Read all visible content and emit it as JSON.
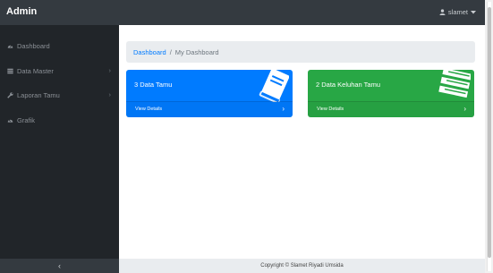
{
  "topbar": {
    "brand": "Admin",
    "user_name": "slamet",
    "user_icon": "user-icon",
    "caret_icon": "caret-down-icon"
  },
  "sidebar": {
    "items": [
      {
        "label": "Dashboard",
        "icon": "dashboard-icon",
        "has_submenu": false
      },
      {
        "label": "Data Master",
        "icon": "table-icon",
        "has_submenu": true
      },
      {
        "label": "Laporan Tamu",
        "icon": "wrench-icon",
        "has_submenu": true
      },
      {
        "label": "Grafik",
        "icon": "chart-icon",
        "has_submenu": false
      }
    ],
    "collapse_glyph": "‹"
  },
  "breadcrumb": {
    "link": "Dashboard",
    "separator": "/",
    "current": "My Dashboard"
  },
  "cards": [
    {
      "title": "3 Data Tamu",
      "footer": "View Details",
      "color": "#007bff",
      "icon": "book-icon"
    },
    {
      "title": "2 Data Keluhan Tamu",
      "footer": "View Details",
      "color": "#28a745",
      "icon": "list-icon"
    }
  ],
  "footer": {
    "text": "Copyright © Slamet Riyadi Umsida"
  }
}
